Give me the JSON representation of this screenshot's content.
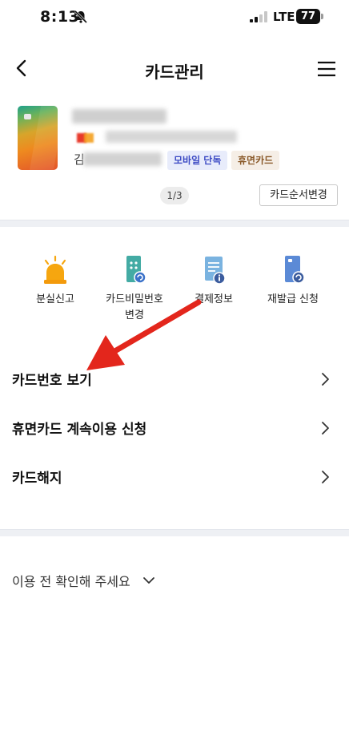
{
  "status_bar": {
    "time": "8:13",
    "network": "LTE",
    "battery": "77"
  },
  "header": {
    "title": "카드관리"
  },
  "card": {
    "name_visible_char": "김",
    "badges": [
      "모바일 단독",
      "휴면카드"
    ],
    "pager": "1/3",
    "order_button": "카드순서변경"
  },
  "quick_menu": [
    {
      "label": "분실신고",
      "icon": "siren-icon"
    },
    {
      "label": "카드비밀번호\n변경",
      "icon": "card-password-icon"
    },
    {
      "label": "결제정보",
      "icon": "payment-info-icon"
    },
    {
      "label": "재발급 신청",
      "icon": "card-reissue-icon"
    }
  ],
  "list": [
    {
      "label": "카드번호 보기"
    },
    {
      "label": "휴면카드 계속이용 신청"
    },
    {
      "label": "카드해지"
    }
  ],
  "notice": {
    "label": "이용 전 확인해 주세요"
  },
  "colors": {
    "accent_arrow": "#e3261c",
    "icon_blue": "#4f7fd8",
    "icon_teal": "#3fa6a0",
    "siren_orange": "#f6a60f"
  }
}
